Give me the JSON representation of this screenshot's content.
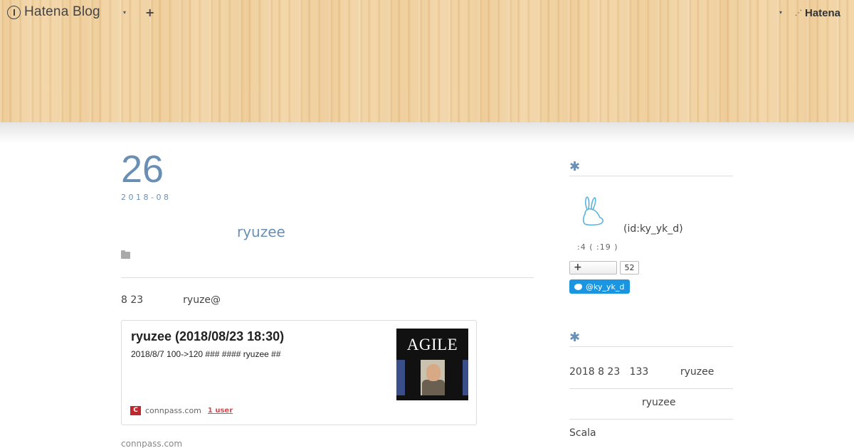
{
  "topbar": {
    "logo_text": "Hatena Blog",
    "dropdown_caret": "▾",
    "add_label": "+",
    "right_caret": "▾",
    "hatena_mark": "⋰",
    "hatena_text": "Hatena"
  },
  "entry": {
    "day": "26",
    "year_month": "2018-08",
    "title": "ryuzee",
    "body_date": "8 23",
    "body_name": "ryuze@",
    "card": {
      "title": "ryuzee (2018/08/23 18:30)",
      "description": "2018/8/7 100->120 ### #### ryuzee ##",
      "thumb_word": "AGILE",
      "site_icon": "C",
      "site": "connpass.com",
      "users": "1 user"
    },
    "source": "connpass.com"
  },
  "sidebar": {
    "section1_marker": "✱",
    "profile_id": "(id:ky_yk_d)",
    "profile_stats": ":4 (  :19  )",
    "hatena_star_plus": "+",
    "bookmark_count": "52",
    "twitter_label": "@ky_yk_d",
    "section2_marker": "✱",
    "item1": "2018 8 23   133          ryuzee",
    "item2": "ryuzee",
    "item3": "Scala"
  },
  "colors": {
    "accent": "#6a8fb5",
    "twitter": "#1b95e0",
    "connpass": "#c1272d"
  }
}
